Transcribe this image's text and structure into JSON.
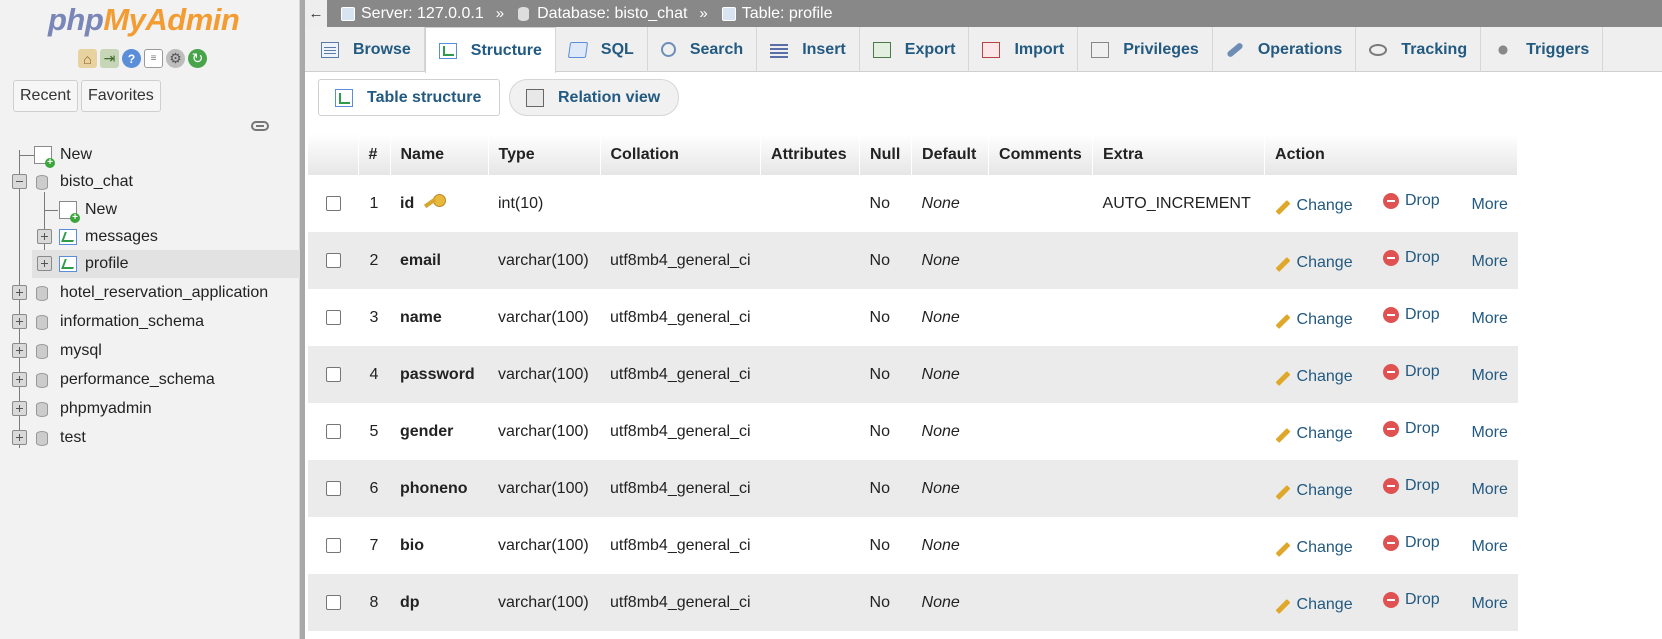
{
  "sidebar": {
    "logo": {
      "php": "php",
      "myadmin": "MyAdmin"
    },
    "quick_icons": [
      "home-icon",
      "exit-icon",
      "help-icon",
      "docs-icon",
      "settings-icon",
      "reload-icon"
    ],
    "recent_label": "Recent",
    "favorites_label": "Favorites",
    "tree": {
      "new": "New",
      "db_bisto": "bisto_chat",
      "db_bisto_new": "New",
      "table_messages": "messages",
      "table_profile": "profile",
      "db_hotel": "hotel_reservation_application",
      "db_info": "information_schema",
      "db_mysql": "mysql",
      "db_perf": "performance_schema",
      "db_pma": "phpmyadmin",
      "db_test": "test"
    }
  },
  "breadcrumb": {
    "server": "Server: 127.0.0.1",
    "sep1": "»",
    "database": "Database: bisto_chat",
    "sep2": "»",
    "table": "Table: profile"
  },
  "tabs": {
    "browse": "Browse",
    "structure": "Structure",
    "sql": "SQL",
    "search": "Search",
    "insert": "Insert",
    "export": "Export",
    "import": "Import",
    "privileges": "Privileges",
    "operations": "Operations",
    "tracking": "Tracking",
    "triggers": "Triggers"
  },
  "subtabs": {
    "table_structure": "Table structure",
    "relation_view": "Relation view"
  },
  "table": {
    "headers": {
      "num": "#",
      "name": "Name",
      "type": "Type",
      "collation": "Collation",
      "attributes": "Attributes",
      "null": "Null",
      "default": "Default",
      "comments": "Comments",
      "extra": "Extra",
      "action": "Action"
    },
    "actions": {
      "change": "Change",
      "drop": "Drop",
      "more": "More"
    },
    "rows": [
      {
        "num": "1",
        "name": "id",
        "type": "int(10)",
        "collation": "",
        "attributes": "",
        "null": "No",
        "default": "None",
        "comments": "",
        "extra": "AUTO_INCREMENT"
      },
      {
        "num": "2",
        "name": "email",
        "type": "varchar(100)",
        "collation": "utf8mb4_general_ci",
        "attributes": "",
        "null": "No",
        "default": "None",
        "comments": "",
        "extra": ""
      },
      {
        "num": "3",
        "name": "name",
        "type": "varchar(100)",
        "collation": "utf8mb4_general_ci",
        "attributes": "",
        "null": "No",
        "default": "None",
        "comments": "",
        "extra": ""
      },
      {
        "num": "4",
        "name": "password",
        "type": "varchar(100)",
        "collation": "utf8mb4_general_ci",
        "attributes": "",
        "null": "No",
        "default": "None",
        "comments": "",
        "extra": ""
      },
      {
        "num": "5",
        "name": "gender",
        "type": "varchar(100)",
        "collation": "utf8mb4_general_ci",
        "attributes": "",
        "null": "No",
        "default": "None",
        "comments": "",
        "extra": ""
      },
      {
        "num": "6",
        "name": "phoneno",
        "type": "varchar(100)",
        "collation": "utf8mb4_general_ci",
        "attributes": "",
        "null": "No",
        "default": "None",
        "comments": "",
        "extra": ""
      },
      {
        "num": "7",
        "name": "bio",
        "type": "varchar(100)",
        "collation": "utf8mb4_general_ci",
        "attributes": "",
        "null": "No",
        "default": "None",
        "comments": "",
        "extra": ""
      },
      {
        "num": "8",
        "name": "dp",
        "type": "varchar(100)",
        "collation": "utf8mb4_general_ci",
        "attributes": "",
        "null": "No",
        "default": "None",
        "comments": "",
        "extra": ""
      }
    ]
  }
}
